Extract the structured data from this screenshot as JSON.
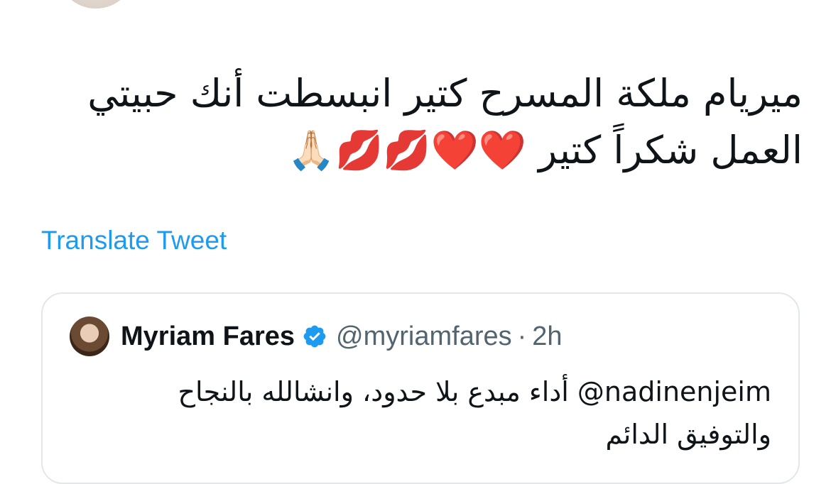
{
  "tweet": {
    "avatar_icon": "user-avatar-icon",
    "text_lines": [
      "ميريام ملكة المسرح كتير انبسطت أنك حبيتي",
      "العمل شكراً كتير ❤️❤️💋💋🙏🏻"
    ],
    "translate_label": "Translate Tweet"
  },
  "quote": {
    "avatar_icon": "quoted-user-avatar-icon",
    "name": "Myriam Fares",
    "verified_icon": "verified-badge-icon",
    "handle": "@myriamfares",
    "separator": "·",
    "time": "2h",
    "mention": "@nadinenjeim",
    "line1_rest": " أداء مبدع بلا حدود، وانشالله بالنجاح",
    "line2": "والتوفيق الدائم"
  },
  "colors": {
    "link": "#1d9bf0",
    "text": "#0f1419",
    "secondary": "#536471",
    "border": "#e3e7ea",
    "verified": "#1d9bf0"
  }
}
